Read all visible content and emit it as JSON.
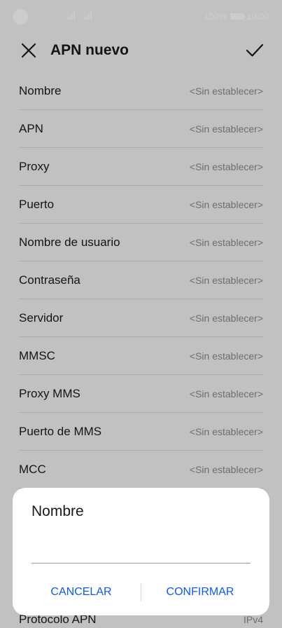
{
  "status_bar": {
    "battery_percent": "100%",
    "time": "10:00"
  },
  "header": {
    "title": "APN nuevo"
  },
  "icons": {
    "close": "close-icon",
    "confirm": "check-icon"
  },
  "fields": [
    {
      "label": "Nombre",
      "value": "<Sin establecer>"
    },
    {
      "label": "APN",
      "value": "<Sin establecer>"
    },
    {
      "label": "Proxy",
      "value": "<Sin establecer>"
    },
    {
      "label": "Puerto",
      "value": "<Sin establecer>"
    },
    {
      "label": "Nombre de usuario",
      "value": "<Sin establecer>"
    },
    {
      "label": "Contraseña",
      "value": "<Sin establecer>"
    },
    {
      "label": "Servidor",
      "value": "<Sin establecer>"
    },
    {
      "label": "MMSC",
      "value": "<Sin establecer>"
    },
    {
      "label": "Proxy MMS",
      "value": "<Sin establecer>"
    },
    {
      "label": "Puerto de MMS",
      "value": "<Sin establecer>"
    },
    {
      "label": "MCC",
      "value": "<Sin establecer>"
    }
  ],
  "bottom_field": {
    "label": "Protocolo APN",
    "value": "IPv4"
  },
  "dialog": {
    "title": "Nombre",
    "input_value": "",
    "cancel_label": "CANCELAR",
    "confirm_label": "CONFIRMAR"
  },
  "colors": {
    "accent": "#0a59f7",
    "background": "#f2f2f2",
    "secondary_text": "#8a8a8a"
  }
}
